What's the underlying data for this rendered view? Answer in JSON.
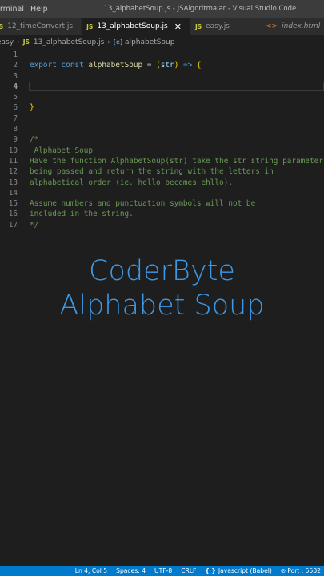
{
  "titlebar": {
    "menu": [
      "erminal",
      "Help"
    ],
    "title": "13_alphabetSoup.js - JSAlgoritmalar - Visual Studio Code"
  },
  "tabs": [
    {
      "label": "12_timeConvert.js",
      "icon": "js-icon",
      "active": false
    },
    {
      "label": "13_alphabetSoup.js",
      "icon": "js-icon",
      "active": true
    },
    {
      "label": "easy.js",
      "icon": "js-icon",
      "active": false
    },
    {
      "label": "index.html",
      "icon": "html-icon",
      "active": false
    }
  ],
  "breadcrumb": {
    "folder": "easy",
    "file": "13_alphabetSoup.js",
    "symbol": "alphabetSoup"
  },
  "editor": {
    "line_numbers": [
      "1",
      "2",
      "3",
      "4",
      "5",
      "6",
      "7",
      "8",
      "9",
      "10",
      "11",
      "12",
      "13",
      "14",
      "15",
      "16",
      "17"
    ],
    "active_line": "4",
    "lines": {
      "l2_kw1": "export",
      "l2_kw2": "const",
      "l2_fn": "alphabetSoup",
      "l2_eq": " = ",
      "l2_paren_open": "(",
      "l2_param": "str",
      "l2_paren_close": ")",
      "l2_arrow": " => ",
      "l2_brace": "{",
      "l6_brace": "}",
      "l9": "/*",
      "l10": " Alphabet Soup",
      "l11": "Have the function AlphabetSoup(str) take the str string parameter",
      "l12": "being passed and return the string with the letters in",
      "l13": "alphabetical order (ie. hello becomes ehllo).",
      "l15": "Assume numbers and punctuation symbols will not be",
      "l16": "included in the string.",
      "l17": "*/"
    }
  },
  "overlay": {
    "line1": "CoderByte",
    "line2": "Alphabet Soup"
  },
  "statusbar": {
    "position": "Ln 4, Col 5",
    "spaces": "Spaces: 4",
    "encoding": "UTF-8",
    "eol": "CRLF",
    "language": "Javascript (Babel)",
    "port": "Port : 5502"
  },
  "colors": {
    "accent": "#007acc",
    "overlay_text": "#3d98e6",
    "comment": "#6a9955",
    "keyword": "#569cd6",
    "function": "#dcdcaa"
  }
}
